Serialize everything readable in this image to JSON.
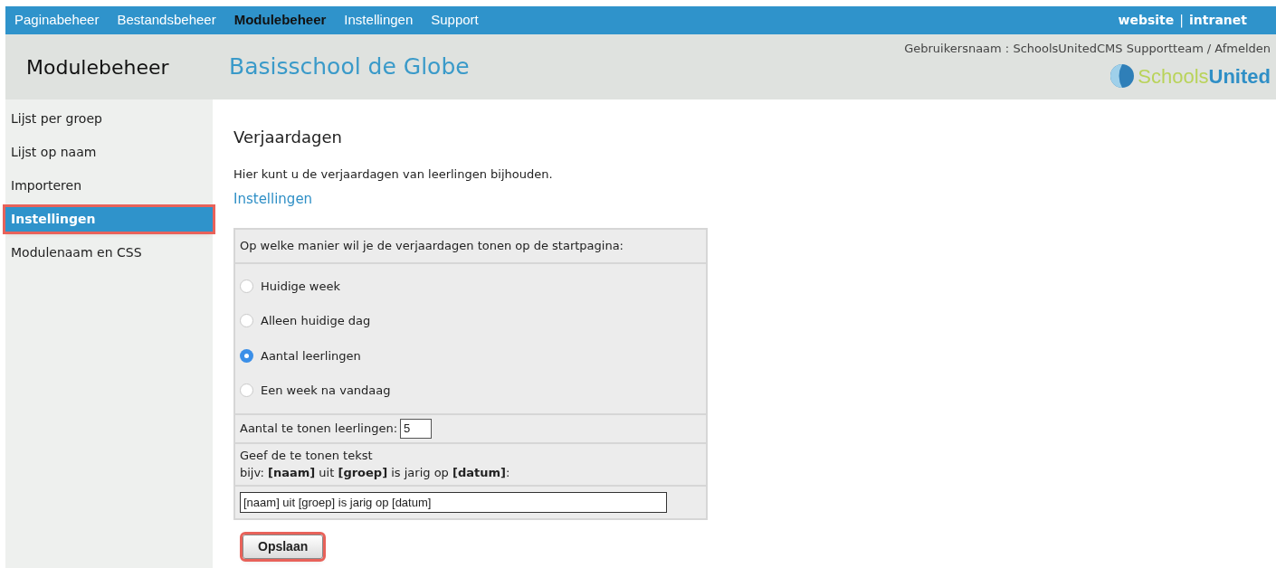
{
  "top_nav": {
    "items": [
      {
        "label": "Paginabeheer",
        "selected": false
      },
      {
        "label": "Bestandsbeheer",
        "selected": false
      },
      {
        "label": "Modulebeheer",
        "selected": true
      },
      {
        "label": "Instellingen",
        "selected": false
      },
      {
        "label": "Support",
        "selected": false
      }
    ],
    "links": [
      "website",
      "intranet"
    ],
    "separator": "|"
  },
  "header": {
    "section_title": "Modulebeheer",
    "site_title": "Basisschool de Globe",
    "user_label": "Gebruikersnaam : SchoolsUnitedCMS Supportteam",
    "separator": "/",
    "logout": "Afmelden",
    "logo_text_1": "Schools",
    "logo_text_2": "United"
  },
  "sidebar": {
    "items": [
      {
        "label": "Lijst per groep",
        "selected": false,
        "highlighted": false
      },
      {
        "label": "Lijst op naam",
        "selected": false,
        "highlighted": false
      },
      {
        "label": "Importeren",
        "selected": false,
        "highlighted": false
      },
      {
        "label": "Instellingen",
        "selected": true,
        "highlighted": true
      },
      {
        "label": "Modulenaam en CSS",
        "selected": false,
        "highlighted": false
      }
    ]
  },
  "content": {
    "title": "Verjaardagen",
    "description": "Hier kunt u de verjaardagen van leerlingen bijhouden.",
    "subtitle": "Instellingen",
    "form": {
      "question": "Op welke manier wil je de verjaardagen tonen op de startpagina:",
      "options": [
        {
          "label": "Huidige week",
          "selected": false
        },
        {
          "label": "Alleen huidige dag",
          "selected": false
        },
        {
          "label": "Aantal leerlingen",
          "selected": true
        },
        {
          "label": "Een week na vandaag",
          "selected": false
        }
      ],
      "count_label": "Aantal te tonen leerlingen:",
      "count_value": "5",
      "text_label": "Geef de te tonen tekst",
      "text_example": "bijv: **[naam]** uit **[groep]** is jarig op **[datum]**:",
      "text_value": "[naam] uit [groep] is jarig op [datum]"
    },
    "save_button": {
      "label": "Opslaan",
      "highlighted": true
    }
  }
}
